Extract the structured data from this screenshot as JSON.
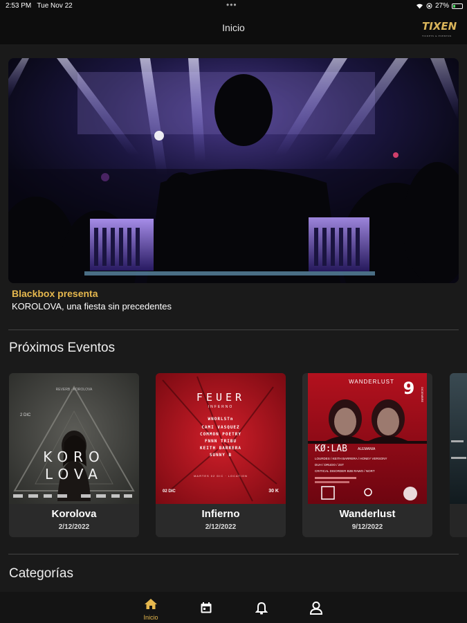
{
  "status_bar": {
    "time": "2:53 PM",
    "date": "Tue Nov 22",
    "battery": "27%",
    "battery_level": 0.27
  },
  "header": {
    "title": "Inicio",
    "logo": "TIXEN"
  },
  "featured": {
    "brand": "Blackbox presenta",
    "subtitle": "KOROLOVA, una fiesta sin precedentes"
  },
  "upcoming": {
    "title": "Próximos Eventos",
    "events": [
      {
        "name": "Korolova",
        "date": "2/12/2022",
        "poster": {
          "line1": "KORO",
          "line2": "LOVA",
          "top_text": "REVERB · KOROLOVA",
          "badge": "2 DIC"
        }
      },
      {
        "name": "Infierno",
        "date": "2/12/2022",
        "poster": {
          "title": "FEUER",
          "subtitle": "INFERNO",
          "lineup": [
            "WNORLSTn",
            "CAMI VASQUEZ",
            "COMMON POETRY",
            "FNNN TRIBU",
            "KEITH BARRERA",
            "SUNNY B"
          ],
          "footer": "MARTES 02 DIC · LOCATION",
          "day": "02 DIC",
          "price": "30 K"
        }
      },
      {
        "name": "Wanderlust",
        "date": "9/12/2022",
        "poster": {
          "title": "WANDERLUST",
          "day": "9",
          "month": "DICIEMBRE",
          "headliner": "KØ:LAB",
          "origin": "ALEMANIA",
          "support1": "LOURDES / KEITH BARRERA / HONEY VERSONY",
          "support2": "DUH / DRUDO / 2ST",
          "support3": "CRITICAL DISORDER B2B RAWO / NORT"
        }
      }
    ]
  },
  "categories": {
    "title": "Categorías"
  },
  "tab_bar": {
    "home_label": "Inicio",
    "accent": "#e6b84e"
  },
  "colors": {
    "accent": "#e6b84e",
    "background": "#1a1a1a",
    "card": "#2a2a2a"
  }
}
